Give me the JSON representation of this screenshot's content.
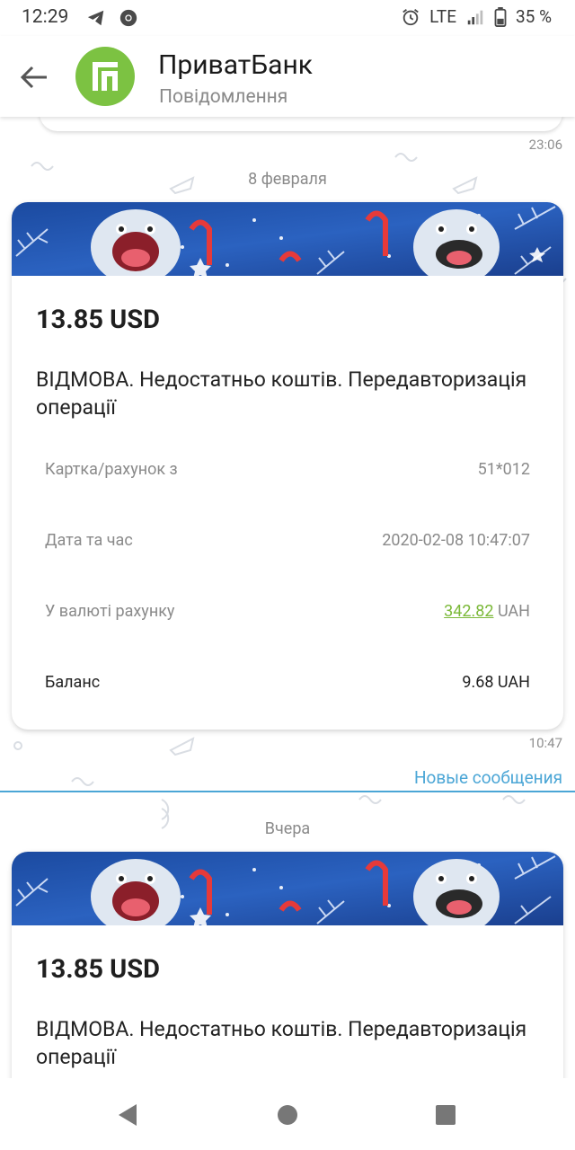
{
  "status_bar": {
    "time": "12:29",
    "network": "LTE",
    "battery": "35 %",
    "icons": [
      "telegram-icon",
      "chrome-icon",
      "alarm-icon",
      "signal-icon",
      "battery-icon"
    ]
  },
  "header": {
    "back_icon": "arrow-left-icon",
    "title": "ПриватБанк",
    "subtitle": "Повідомлення"
  },
  "chat": {
    "prev_time": "23:06",
    "date_1": "8 февраля",
    "message_1": {
      "amount": "13.85 USD",
      "text": "ВІДМОВА. Недостатньо коштів. Передавторизація операції",
      "rows": [
        {
          "label": "Картка/рахунок з",
          "value": "51*012"
        },
        {
          "label": "Дата та час",
          "value": "2020-02-08 10:47:07"
        },
        {
          "label": "У валюті рахунку",
          "value_link": "342.82",
          "value_suffix": "UAH"
        },
        {
          "label": "Баланс",
          "value": "9.68 UAH"
        }
      ],
      "time": "10:47"
    },
    "new_messages": "Новые сообщения",
    "date_2": "Вчера",
    "message_2": {
      "amount": "13.85 USD",
      "text": "ВІДМОВА. Недостатньо коштів. Передавторизація операції"
    }
  },
  "colors": {
    "accent_green": "#7cc242",
    "link_green": "#7cb93a",
    "new_messages_blue": "#4ba6d6",
    "banner_blue": "#1f4ea8"
  },
  "nav_bar": {
    "icons": [
      "back-triangle-icon",
      "home-circle-icon",
      "recents-square-icon"
    ]
  }
}
